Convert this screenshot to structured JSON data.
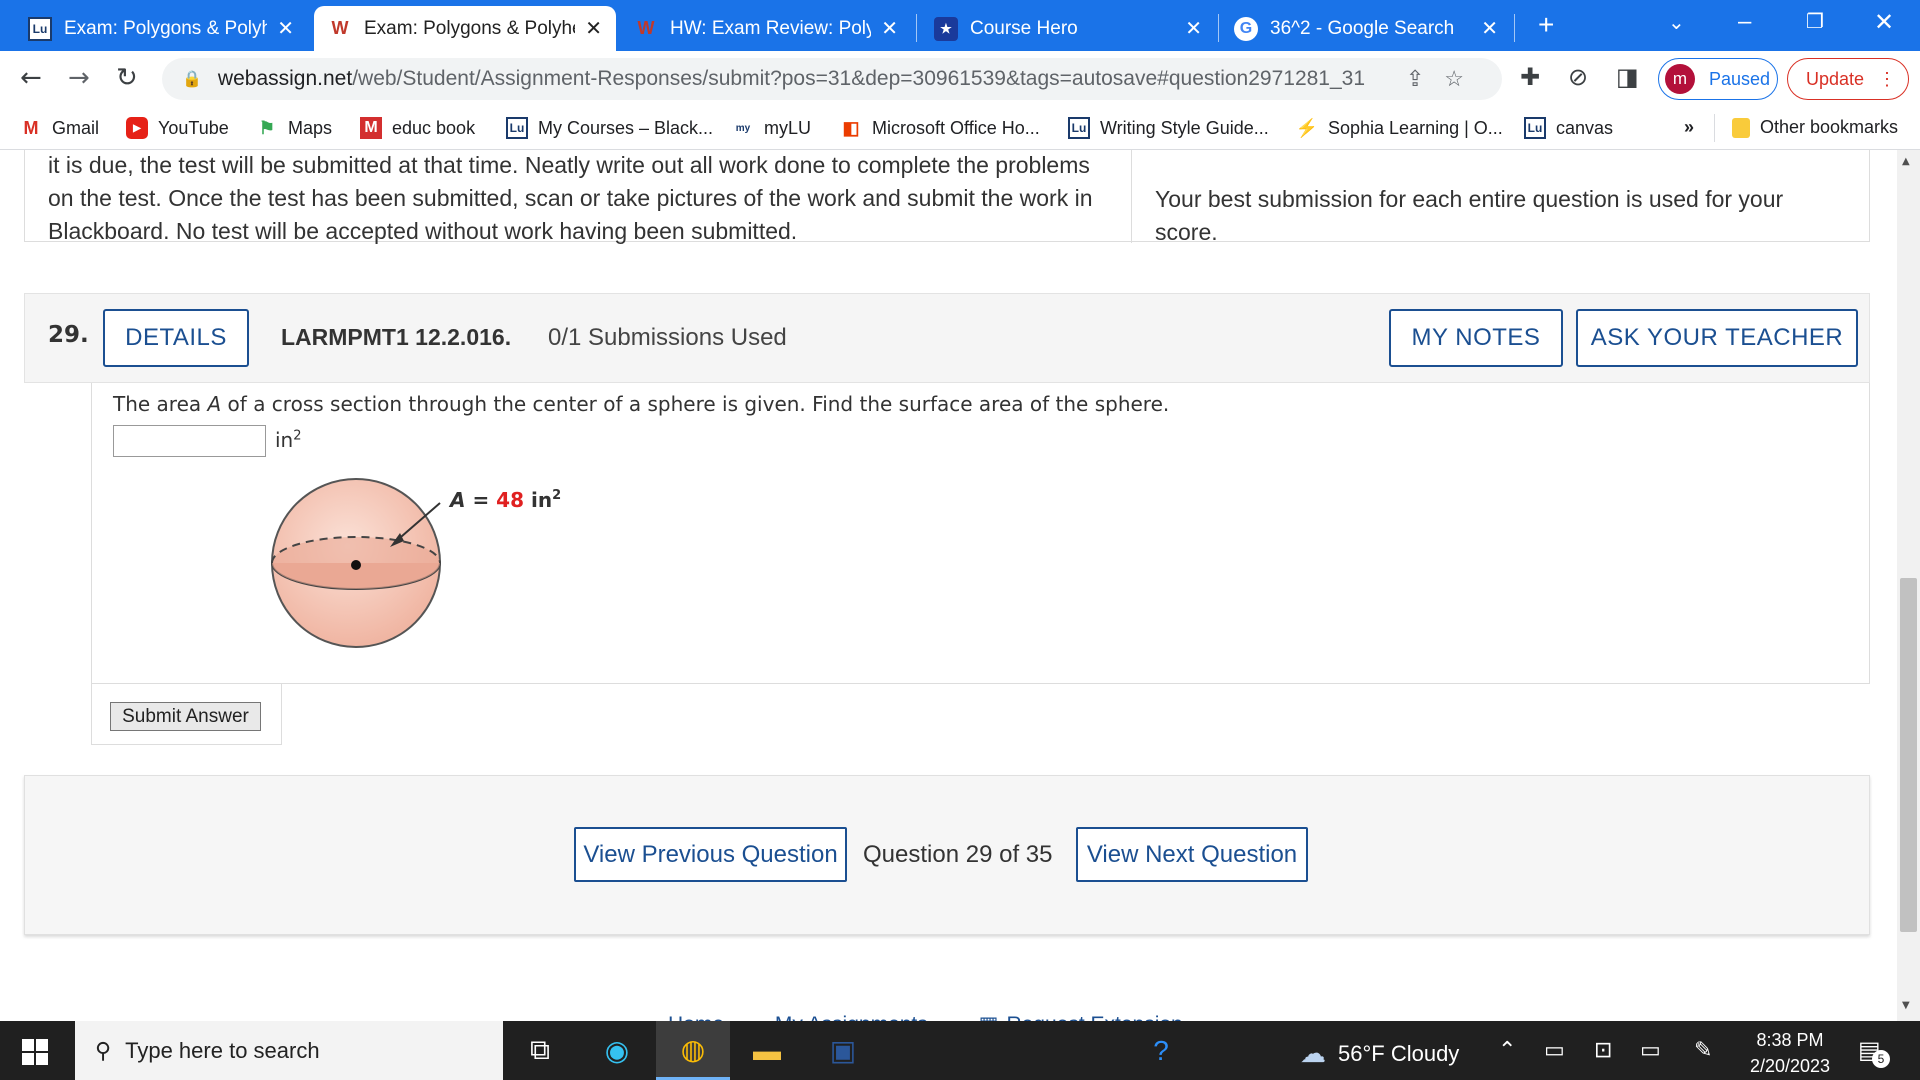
{
  "browser": {
    "tabs": [
      {
        "title": "Exam: Polygons & Polyhe",
        "icon": "lu-icon"
      },
      {
        "title": "Exam: Polygons & Polyhe",
        "icon": "webassign-icon"
      },
      {
        "title": "HW: Exam Review: Polygo",
        "icon": "webassign-icon"
      },
      {
        "title": "Course Hero",
        "icon": "coursehero-icon"
      },
      {
        "title": "36^2 - Google Search",
        "icon": "google-icon"
      }
    ],
    "new_tab": "+",
    "url_host": "webassign.net",
    "url_path": "/web/Student/Assignment-Responses/submit?pos=31&dep=30961539&tags=autosave#question2971281_31",
    "profile_initial": "m",
    "profile_status": "Paused",
    "update_label": "Update"
  },
  "bookmarks": [
    {
      "label": "Gmail"
    },
    {
      "label": "YouTube"
    },
    {
      "label": "Maps"
    },
    {
      "label": "educ book"
    },
    {
      "label": "My Courses – Black..."
    },
    {
      "label": "myLU"
    },
    {
      "label": "Microsoft Office Ho..."
    },
    {
      "label": "Writing Style Guide..."
    },
    {
      "label": "Sophia Learning | O..."
    },
    {
      "label": "canvas"
    }
  ],
  "bookmarks_more": "»",
  "other_bookmarks": "Other bookmarks",
  "page": {
    "intro_left": "it is due, the test will be submitted at that time. Neatly write out all work done to complete the problems on the test. Once the test has been submitted, scan or take pictures of the work and submit the work in Blackboard. No test will be accepted without work having been submitted.",
    "intro_right": "Your best submission for each entire question is used for your score.",
    "question": {
      "number": "29.",
      "details_label": "DETAILS",
      "code": "LARMPMT1 12.2.016.",
      "submissions": "0/1 Submissions Used",
      "my_notes_label": "MY NOTES",
      "ask_teacher_label": "ASK YOUR TEACHER",
      "text_before": "The area ",
      "text_var": "A",
      "text_after": " of a cross section through the center of a sphere is given. Find the surface area of the sphere.",
      "answer_value": "",
      "unit_base": "in",
      "unit_exp": "2",
      "figure_label_var": "A",
      "figure_label_eq": " = ",
      "figure_label_value": "48",
      "figure_label_unit": " in",
      "figure_label_exp": "2",
      "submit_label": "Submit Answer"
    },
    "navigation": {
      "prev_label": "View Previous Question",
      "counter": "Question 29 of 35",
      "next_label": "View Next Question"
    },
    "footer_links": [
      "Home",
      "My Assignments",
      "Request Extension"
    ]
  },
  "taskbar": {
    "search_placeholder": "Type here to search",
    "weather": "56°F  Cloudy",
    "time": "8:38 PM",
    "date": "2/20/2023",
    "notifications": "5"
  },
  "colors": {
    "chrome_blue": "#1a73e8",
    "webassign_blue": "#1b4f91",
    "figure_value_red": "#e02020",
    "sphere_fill": "#f4c4b4"
  }
}
